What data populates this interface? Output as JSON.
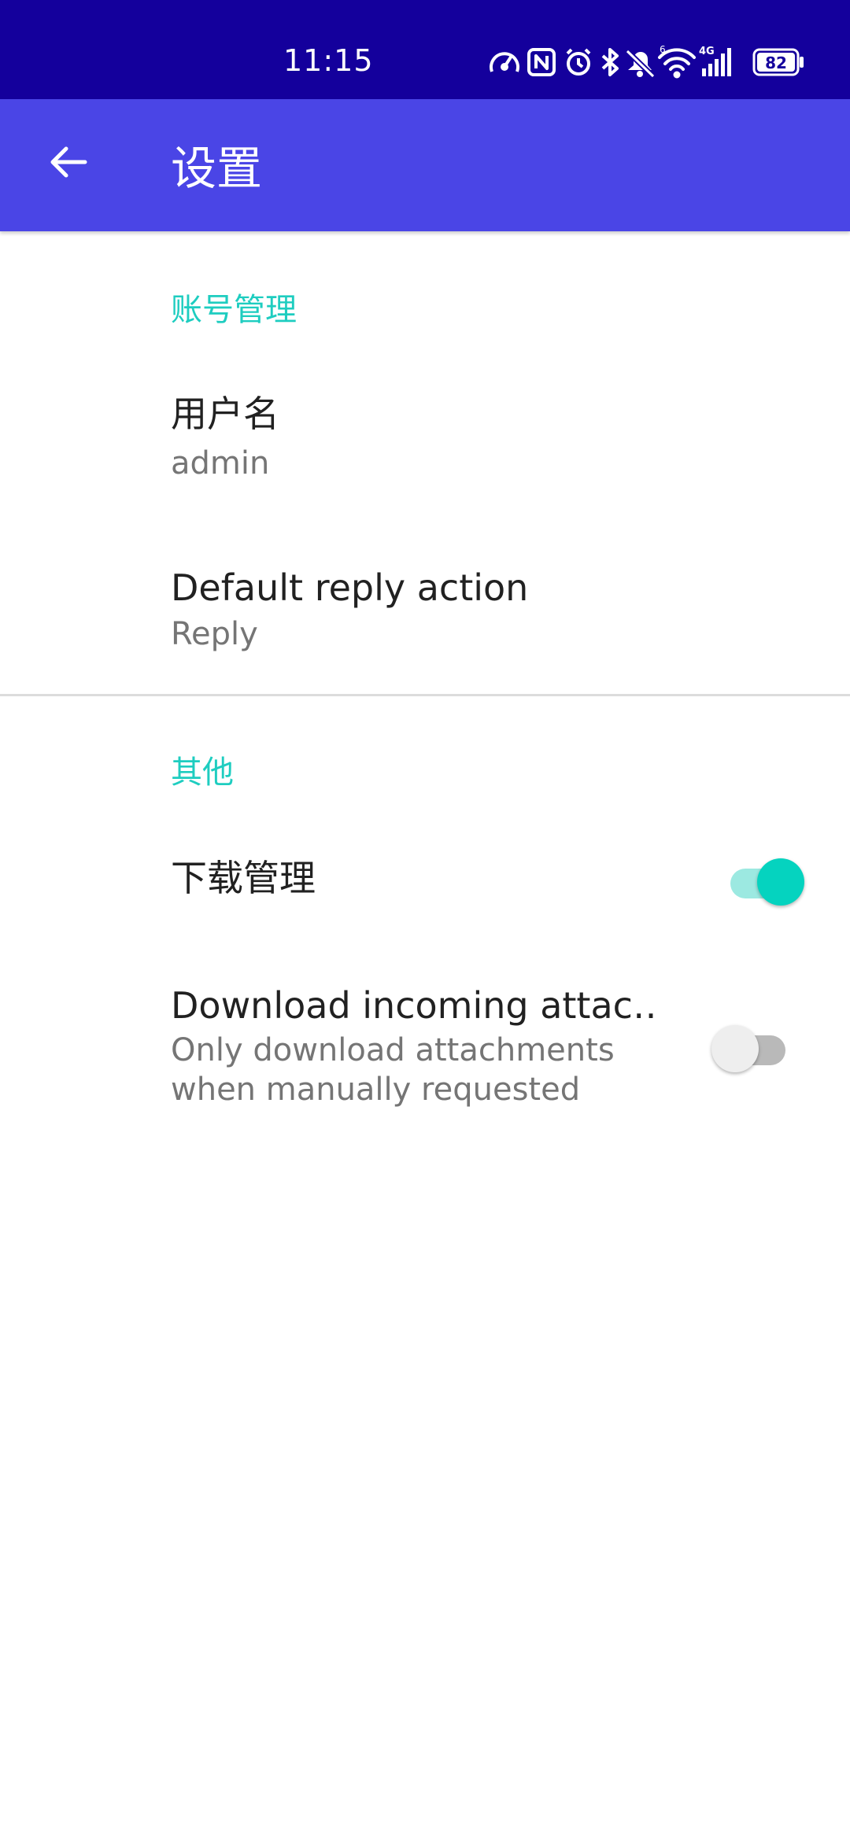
{
  "status_bar": {
    "time": "11:15",
    "battery_level": "82",
    "icons": [
      "speedometer-icon",
      "nfc-icon",
      "alarm-icon",
      "bluetooth-icon",
      "mute-bell-icon",
      "wifi-icon",
      "signal-4g-icon",
      "battery-icon"
    ]
  },
  "app_bar": {
    "back_icon": "arrow-left-icon",
    "title": "设置",
    "background_color": "#4a45e6"
  },
  "colors": {
    "status_bar": "#14009c",
    "accent": "#1ecdc0",
    "switch_on": "#05d3bf"
  },
  "sections": [
    {
      "category": "账号管理",
      "items": [
        {
          "title": "用户名",
          "summary": "admin"
        },
        {
          "title": "Default reply action",
          "summary": "Reply"
        }
      ]
    },
    {
      "category": "其他",
      "items": [
        {
          "title": "下载管理",
          "switch": true
        },
        {
          "title": "Download incoming attac‥",
          "summary_line1": "Only download attachments",
          "summary_line2": "when manually requested",
          "switch": false
        }
      ]
    }
  ]
}
